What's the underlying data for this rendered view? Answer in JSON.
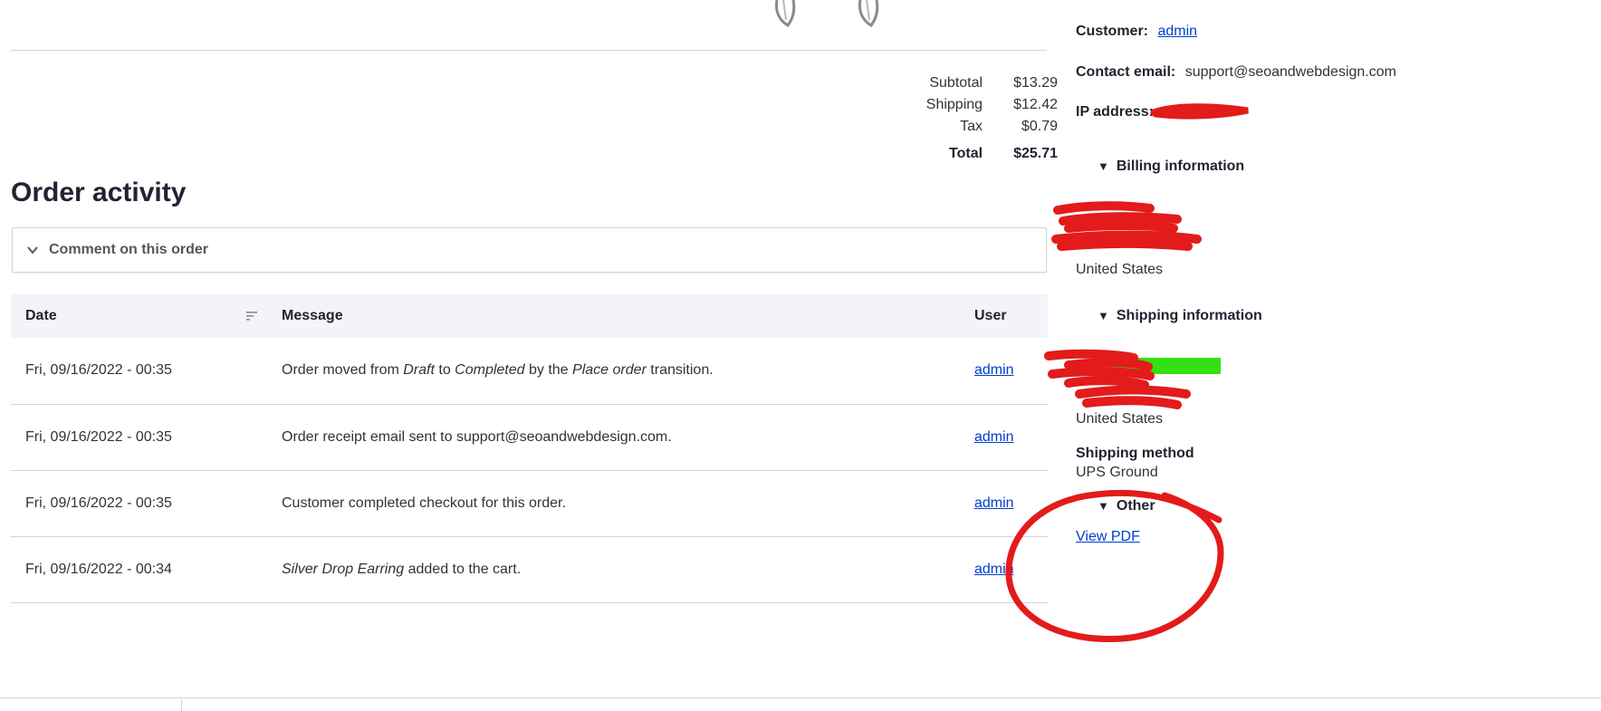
{
  "totals": {
    "subtotal_label": "Subtotal",
    "subtotal_value": "$13.29",
    "shipping_label": "Shipping",
    "shipping_value": "$12.42",
    "tax_label": "Tax",
    "tax_value": "$0.79",
    "total_label": "Total",
    "total_value": "$25.71"
  },
  "activity": {
    "title": "Order activity",
    "comment_label": "Comment on this order",
    "columns": {
      "date": "Date",
      "message": "Message",
      "user": "User"
    },
    "rows": [
      {
        "date": "Fri, 09/16/2022 - 00:35",
        "user": "admin",
        "msg": {
          "a": "Order moved from ",
          "b": "Draft",
          "c": " to ",
          "d": "Completed",
          "e": " by the ",
          "f": "Place order",
          "g": " transition."
        }
      },
      {
        "date": "Fri, 09/16/2022 - 00:35",
        "user": "admin",
        "msg": "Order receipt email sent to support@seoandwebdesign.com."
      },
      {
        "date": "Fri, 09/16/2022 - 00:35",
        "user": "admin",
        "msg": "Customer completed checkout for this order."
      },
      {
        "date": "Fri, 09/16/2022 - 00:34",
        "user": "admin",
        "msg": {
          "a": "Silver Drop Earring",
          "b": " added to the cart."
        }
      }
    ]
  },
  "sidebar": {
    "customer_label": "Customer:",
    "customer_value": "admin",
    "contact_label": "Contact email:",
    "contact_value": "support@seoandwebdesign.com",
    "ip_label": "IP address:",
    "billing_label": "Billing information",
    "billing_country": "United States",
    "shipping_label": "Shipping information",
    "shipping_country": "United States",
    "shipping_method_label": "Shipping method",
    "shipping_method_value": "UPS Ground",
    "other_label": "Other",
    "view_pdf": "View PDF"
  },
  "colors": {
    "link": "#003ecc",
    "redact_red": "#e31b1b",
    "redact_green": "#33e012",
    "table_header_bg": "#f3f4f9"
  }
}
